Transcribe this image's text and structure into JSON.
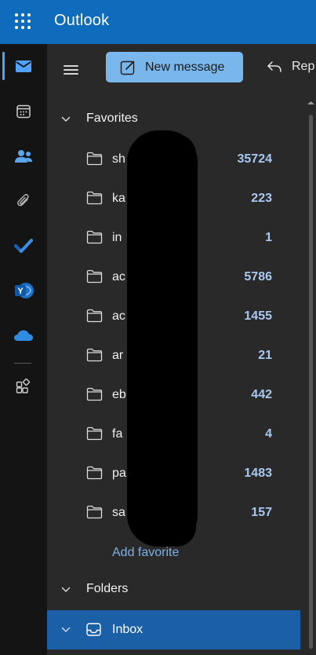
{
  "app": {
    "title": "Outlook"
  },
  "rail": {
    "items": [
      {
        "name": "mail",
        "active": true
      },
      {
        "name": "calendar",
        "active": false
      },
      {
        "name": "people",
        "active": false
      },
      {
        "name": "files",
        "active": false
      },
      {
        "name": "todo",
        "active": false
      },
      {
        "name": "yammer",
        "active": false
      },
      {
        "name": "onedrive",
        "active": false
      },
      {
        "name": "apps",
        "active": false
      }
    ],
    "colors": {
      "todo": "#3b8ee6",
      "yammer": "#2b7ccc",
      "onedrive": "#2f8ce0"
    }
  },
  "toolbar": {
    "new_message_label": "New message",
    "reply_label": "Rep"
  },
  "favorites": {
    "heading": "Favorites",
    "items": [
      {
        "label": "sh",
        "count": "35724"
      },
      {
        "label": "ka",
        "count": "223"
      },
      {
        "label": "in",
        "count": "1"
      },
      {
        "label": "ac",
        "count": "5786"
      },
      {
        "label": "ac",
        "count": "1455"
      },
      {
        "label": "ar",
        "count": "21"
      },
      {
        "label": "eb",
        "count": "442"
      },
      {
        "label": "fa",
        "count": "4"
      },
      {
        "label": "pa",
        "count": "1483"
      },
      {
        "label": "sa",
        "count": "157"
      }
    ],
    "add_label": "Add favorite"
  },
  "folders": {
    "heading": "Folders",
    "inbox_label": "Inbox"
  },
  "colors": {
    "brand": "#0f6cbd",
    "selected": "#1b5fa6",
    "count": "#a9c8f0",
    "link": "#7fb0e6"
  }
}
